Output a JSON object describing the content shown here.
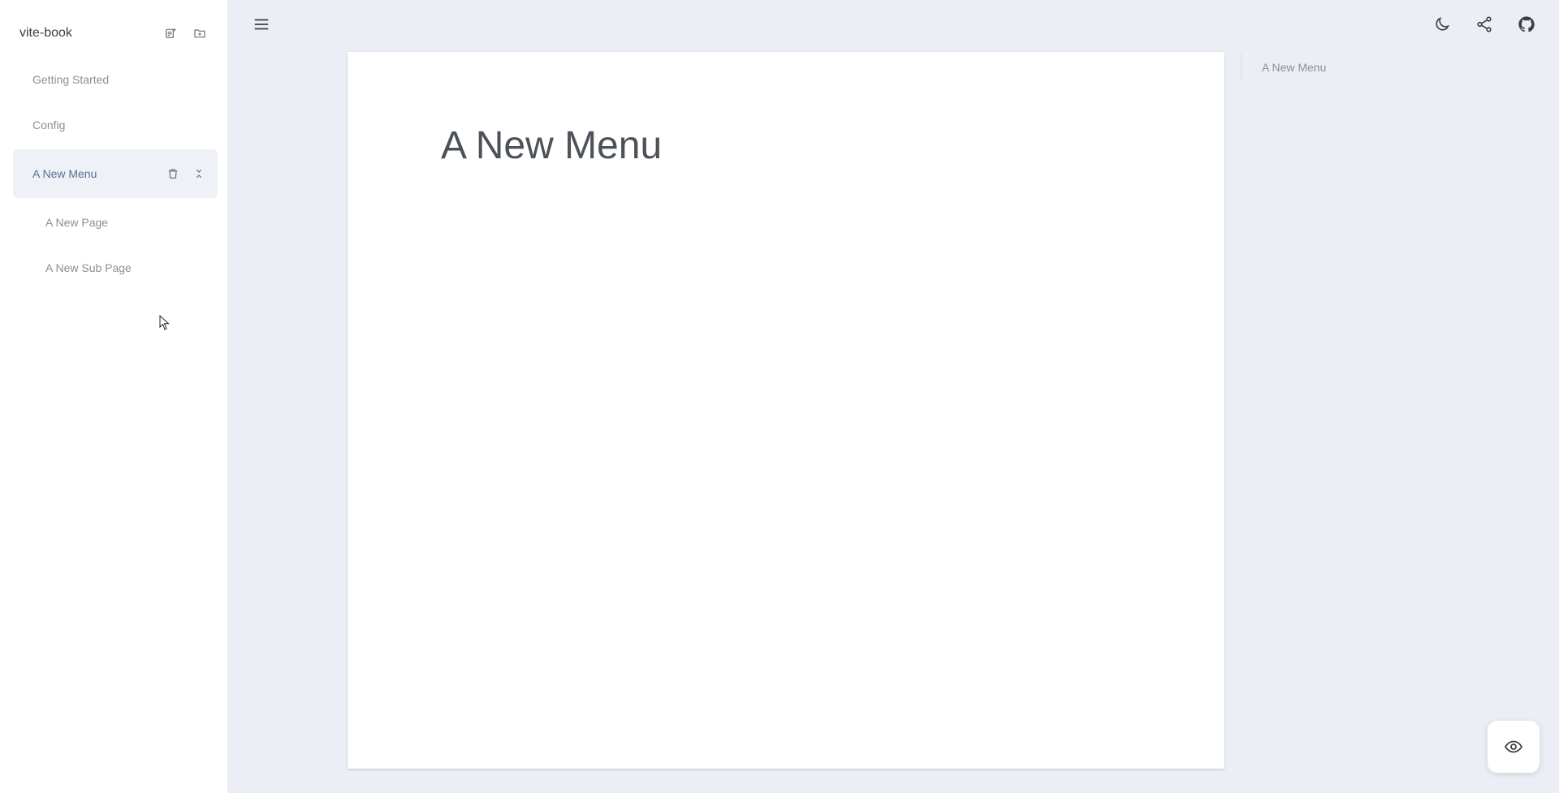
{
  "sidebar": {
    "title": "vite-book",
    "header_icons": [
      "add-page-icon",
      "add-folder-icon"
    ],
    "items": [
      {
        "label": "Getting Started",
        "level": 0,
        "active": false
      },
      {
        "label": "Config",
        "level": 0,
        "active": false
      },
      {
        "label": "A New Menu",
        "level": 0,
        "active": true,
        "actions": [
          "trash-icon",
          "collapse-icon"
        ]
      },
      {
        "label": "A New Page",
        "level": 1,
        "active": false
      },
      {
        "label": "A New Sub Page",
        "level": 1,
        "active": false
      }
    ]
  },
  "topbar": {
    "icons": [
      "menu-icon",
      "moon-icon",
      "share-icon",
      "github-icon"
    ]
  },
  "main": {
    "title": "A New Menu"
  },
  "toc": {
    "items": [
      "A New Menu"
    ]
  },
  "fab": {
    "icon": "eye-icon"
  },
  "colors": {
    "background": "#ebeff5",
    "sidebar": "#ffffff",
    "active_item_bg": "#eef1f6",
    "active_item_text": "#5a6f96",
    "muted_text": "#8a8f97"
  }
}
